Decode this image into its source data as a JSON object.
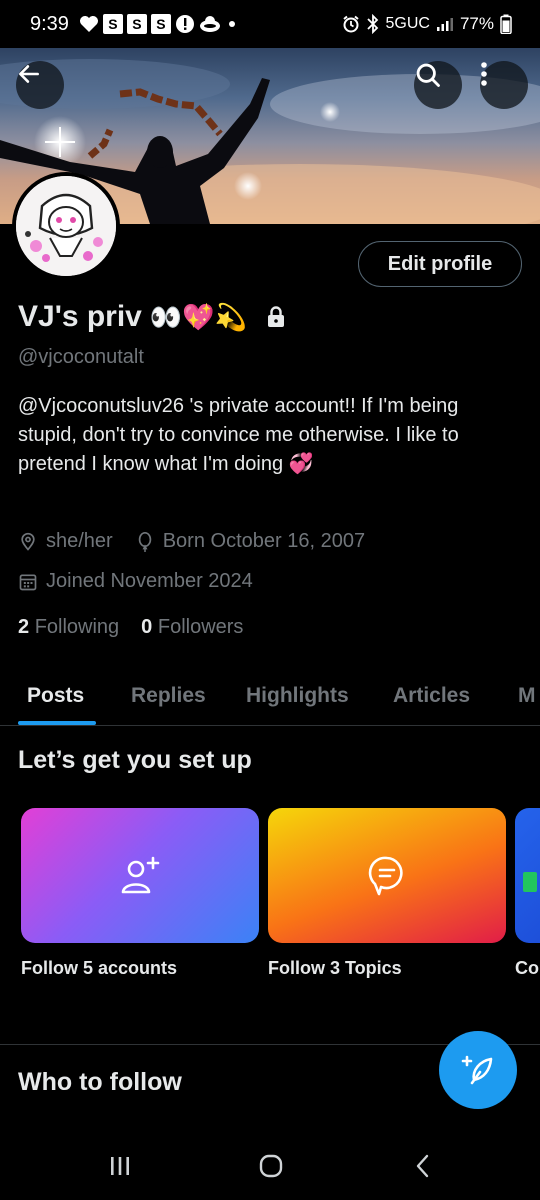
{
  "status_bar": {
    "time": "9:39",
    "boxes": [
      "S",
      "S",
      "S"
    ],
    "network": "5GUC",
    "battery": "77%"
  },
  "profile": {
    "display_name": "VJ's priv",
    "emoji": "👀💖💫",
    "handle": "@vjcoconutalt",
    "bio": "@Vjcoconutsluv26 's private account!!  If I'm being stupid, don't try to convince me otherwise. I like to pretend I know what I'm doing 💞",
    "pronouns": "she/her",
    "born": "Born October 16, 2007",
    "joined": "Joined November 2024",
    "following_count": "2",
    "following_label": "Following",
    "followers_count": "0",
    "followers_label": "Followers",
    "edit_profile_label": "Edit profile"
  },
  "tabs": [
    "Posts",
    "Replies",
    "Highlights",
    "Articles",
    "M"
  ],
  "setup": {
    "title": "Let’s get you set up",
    "cards": [
      {
        "label": "Follow 5 accounts",
        "icon": "add-user-icon"
      },
      {
        "label": "Follow 3 Topics",
        "icon": "topics-icon"
      },
      {
        "label": "Co",
        "icon": "partial-card-icon"
      }
    ]
  },
  "who_to_follow": {
    "title": "Who to follow"
  },
  "colors": {
    "accent": "#1d9bf0",
    "background": "#000000",
    "text_primary": "#e7e9ea",
    "text_secondary": "#71767b",
    "border": "#2f3336"
  }
}
